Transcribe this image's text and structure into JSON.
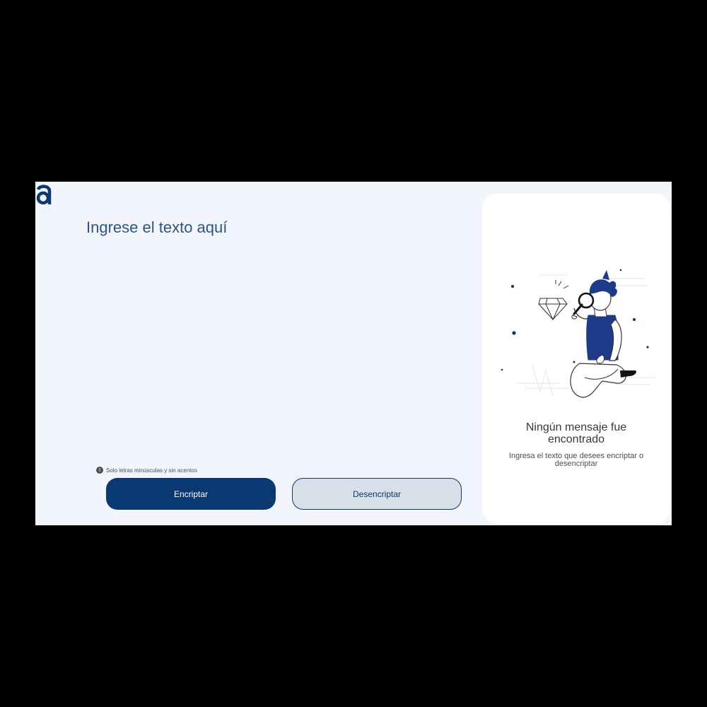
{
  "input": {
    "placeholder": "Ingrese el texto aquí",
    "value": ""
  },
  "hint": {
    "icon": "info-icon",
    "text": "Solo letras minúsculas y sin acentos"
  },
  "buttons": {
    "encrypt_label": "Encriptar",
    "decrypt_label": "Desencriptar"
  },
  "output_panel": {
    "title": "Ningún mensaje fue encontrado",
    "subtitle": "Ingresa el texto que desees encriptar o desencriptar",
    "illustration": "person-with-magnifying-glass-illustration"
  },
  "colors": {
    "page_background": "#f3f5fc",
    "primary": "#0a3871",
    "secondary_button": "#d8dfe8",
    "panel_background": "#ffffff",
    "frame": "#000000"
  }
}
